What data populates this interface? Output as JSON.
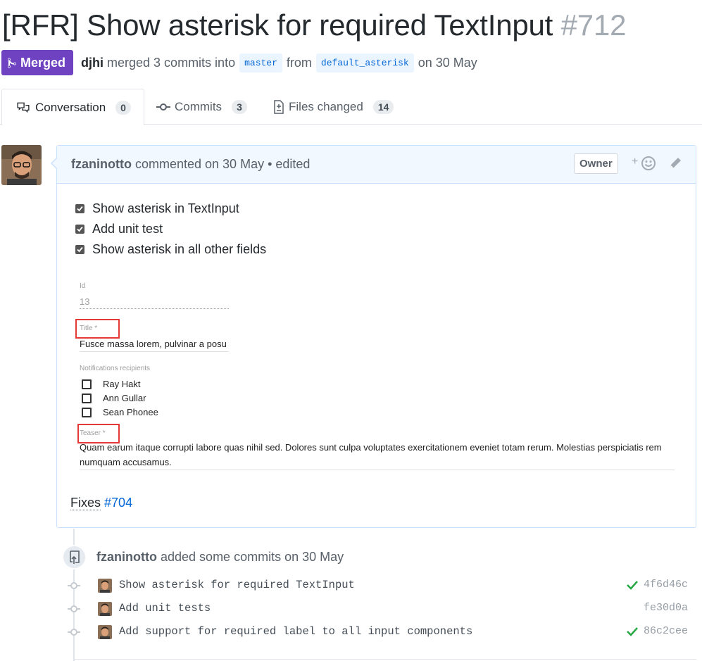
{
  "pr": {
    "title": "[RFR] Show asterisk for required TextInput",
    "number": "#712",
    "state_label": "Merged",
    "author": "djhi",
    "merged_text": "merged 3 commits into",
    "base_branch": "master",
    "from_text": "from",
    "head_branch": "default_asterisk",
    "date_text": "on 30 May"
  },
  "tabs": [
    {
      "label": "Conversation",
      "count": "0"
    },
    {
      "label": "Commits",
      "count": "3"
    },
    {
      "label": "Files changed",
      "count": "14"
    }
  ],
  "comment": {
    "author": "fzaninotto",
    "meta": "commented on 30 May • edited",
    "role_badge": "Owner",
    "reaction_plus": "+",
    "tasks": [
      "Show asterisk in TextInput",
      "Add unit test",
      "Show asterisk in all other fields"
    ],
    "screenshot": {
      "id_label": "Id",
      "id_value": "13",
      "title_label": "Title *",
      "title_value": "Fusce massa lorem, pulvinar a posu",
      "recipients_label": "Notifications recipients",
      "recipients": [
        "Ray Hakt",
        "Ann Gullar",
        "Sean Phonee"
      ],
      "teaser_label": "Teaser *",
      "teaser_line1": "Quam earum itaque corrupti labore quas nihil sed. Dolores sunt culpa voluptates exercitationem eveniet totam rerum. Molestias perspiciatis rem",
      "teaser_line2": "numquam accusamus."
    },
    "fixes_label": "Fixes",
    "fixes_link": "#704"
  },
  "event": {
    "author": "fzaninotto",
    "text": "added some commits on 30 May"
  },
  "commits": [
    {
      "message": "Show asterisk for required TextInput",
      "sha": "4f6d46c",
      "status": "success"
    },
    {
      "message": "Add unit tests",
      "sha": "fe30d0a",
      "status": "none"
    },
    {
      "message": "Add support for required label to all input components",
      "sha": "86c2cee",
      "status": "success"
    }
  ],
  "colors": {
    "merged": "#6f42c1",
    "link": "#0366d6",
    "success": "#28a745",
    "highlight_box": "#e53935"
  }
}
